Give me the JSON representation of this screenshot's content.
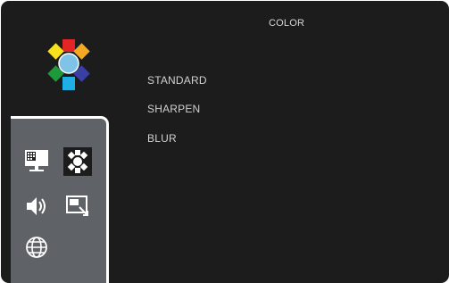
{
  "header": {
    "title": "COLOR"
  },
  "menu": {
    "items": [
      {
        "label": "STANDARD"
      },
      {
        "label": "SHARPEN"
      },
      {
        "label": "BLUR"
      }
    ]
  },
  "sidebar": {
    "icons": [
      {
        "name": "picture-icon",
        "selected": false
      },
      {
        "name": "color-icon",
        "selected": true
      },
      {
        "name": "sound-icon",
        "selected": false
      },
      {
        "name": "display-resize-icon",
        "selected": false
      },
      {
        "name": "globe-icon",
        "selected": false
      }
    ]
  },
  "colors": {
    "background": "#1c1c1c",
    "panel": "#5f6266",
    "text": "#d0d0d0",
    "logo_petals": [
      "#e32526",
      "#f7a823",
      "#f7e21b",
      "#3a3fa6",
      "#20aee6",
      "#1f9a3a",
      "#7fc3e8"
    ]
  }
}
